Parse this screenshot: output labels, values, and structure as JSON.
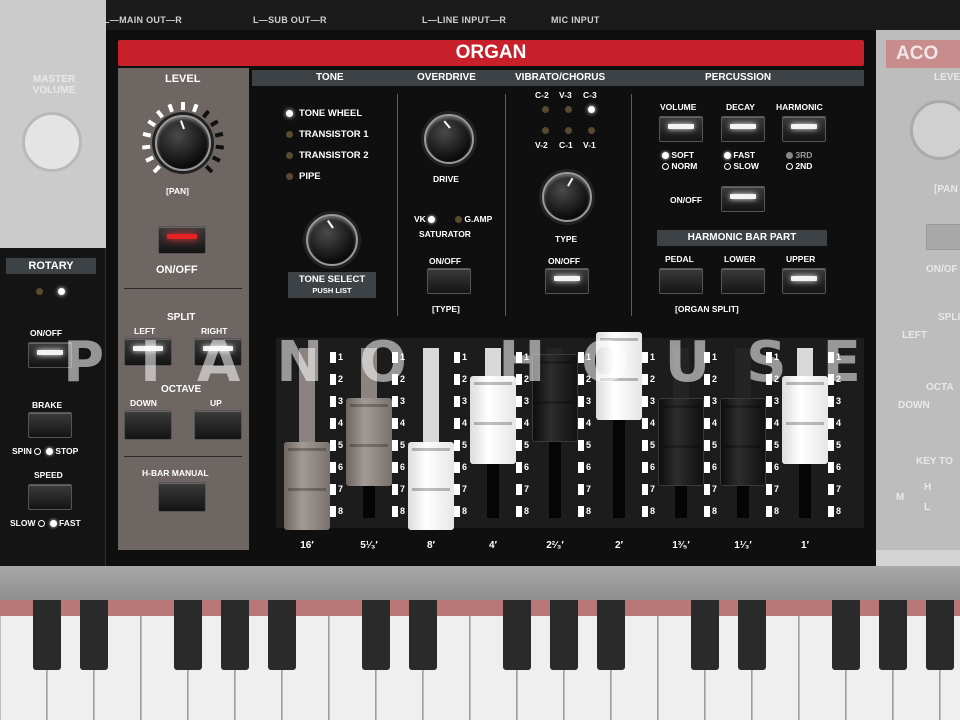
{
  "io": {
    "out1": "R",
    "main_out": "L—MAIN OUT—R",
    "sub_out": "L—SUB OUT—R",
    "line_input": "L—LINE INPUT—R",
    "mic_input": "MIC INPUT"
  },
  "left_faded": {
    "master_volume": "MASTER VOLUME"
  },
  "rotary": {
    "title": "ROTARY",
    "on_off": "ON/OFF",
    "brake": "BRAKE",
    "spin": "SPIN",
    "stop": "STOP",
    "speed": "SPEED",
    "slow": "SLOW",
    "fast": "FAST"
  },
  "organ": {
    "title": "ORGAN"
  },
  "level": {
    "title": "LEVEL",
    "pan": "[PAN]",
    "on_off": "ON/OFF"
  },
  "split": {
    "title": "SPLIT",
    "left": "LEFT",
    "right": "RIGHT"
  },
  "octave": {
    "title": "OCTAVE",
    "down": "DOWN",
    "up": "UP"
  },
  "hbar": {
    "title": "H-BAR MANUAL"
  },
  "tone": {
    "title": "TONE",
    "items": [
      "TONE WHEEL",
      "TRANSISTOR 1",
      "TRANSISTOR 2",
      "PIPE"
    ],
    "selected": 0,
    "select_label": "TONE SELECT",
    "push_list": "PUSH LIST"
  },
  "overdrive": {
    "title": "OVERDRIVE",
    "drive": "DRIVE",
    "vk": "VK",
    "gamp": "G.AMP",
    "saturator": "SATURATOR",
    "on_off": "ON/OFF",
    "type": "[TYPE]"
  },
  "vibrato": {
    "title": "VIBRATO/CHORUS",
    "top": [
      "C-2",
      "V-3",
      "C-3"
    ],
    "bottom": [
      "V-2",
      "C-1",
      "V-1"
    ],
    "type": "TYPE",
    "on_off": "ON/OFF"
  },
  "percussion": {
    "title": "PERCUSSION",
    "volume": "VOLUME",
    "decay": "DECAY",
    "harmonic": "HARMONIC",
    "soft": "SOFT",
    "norm": "NORM",
    "fast": "FAST",
    "slow": "SLOW",
    "third": "3RD",
    "second": "2ND",
    "on_off": "ON/OFF"
  },
  "harmonic_bar": {
    "title": "HARMONIC BAR PART",
    "pedal": "PEDAL",
    "lower": "LOWER",
    "upper": "UPPER",
    "organ_split": "[ORGAN SPLIT]"
  },
  "drawbars": {
    "footages": [
      "16′",
      "5¹⁄₃′",
      "8′",
      "4′",
      "2²⁄₃′",
      "2′",
      "1³⁄₅′",
      "1¹⁄₃′",
      "1′"
    ],
    "colors": [
      "brown",
      "brown",
      "white",
      "white",
      "black",
      "white",
      "black",
      "black",
      "white"
    ],
    "levels": [
      6,
      4,
      6,
      3,
      2,
      1,
      4,
      4,
      3
    ],
    "numbers": [
      "1",
      "2",
      "3",
      "4",
      "5",
      "6",
      "7",
      "8"
    ]
  },
  "right_faded": {
    "acou": "ACO",
    "level": "LEVE",
    "pan": "[PAN",
    "on_off": "ON/OF",
    "split": "SPLI",
    "left": "LEFT",
    "octave": "OCTA",
    "down": "DOWN",
    "key": "KEY TO",
    "h": "H",
    "m": "M",
    "l": "L"
  },
  "watermark": "PIANO HOUSE"
}
